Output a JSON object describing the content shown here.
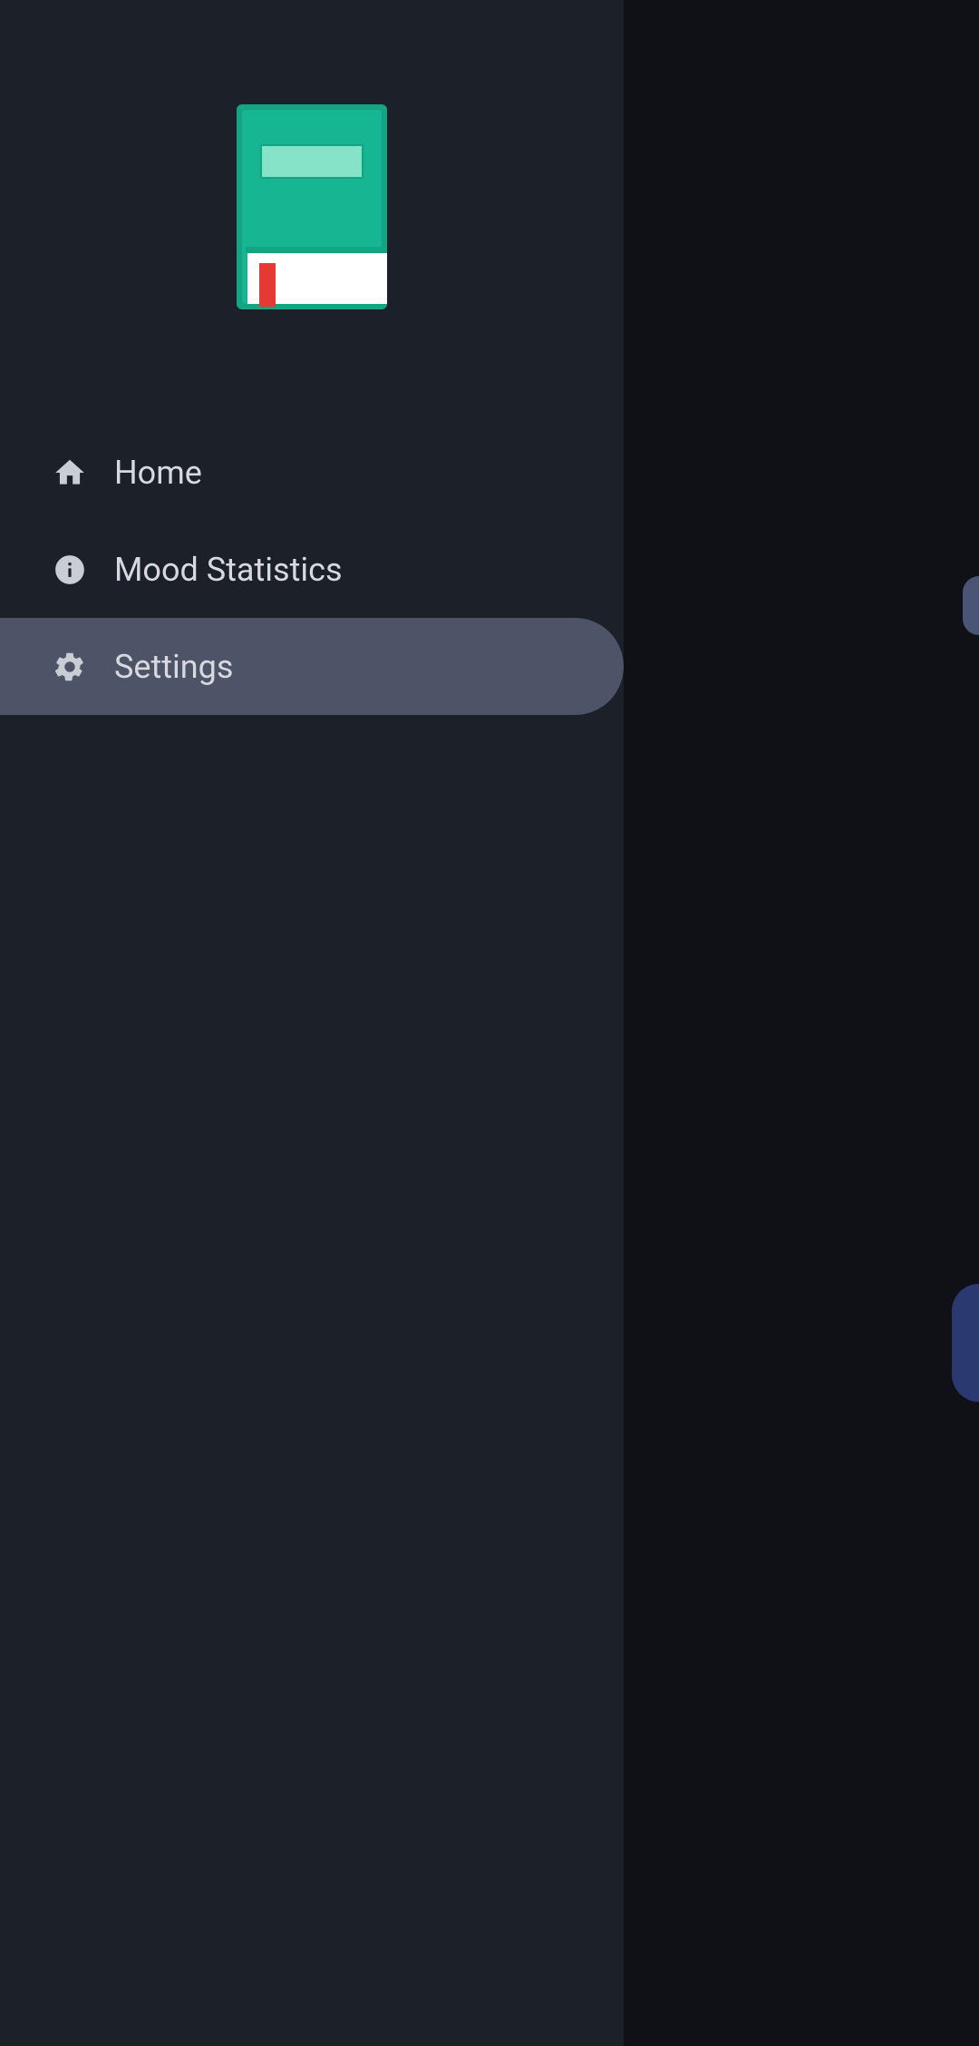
{
  "nav": {
    "items": [
      {
        "label": "Home",
        "active": false
      },
      {
        "label": "Mood Statistics",
        "active": false
      },
      {
        "label": "Settings",
        "active": true
      }
    ]
  }
}
